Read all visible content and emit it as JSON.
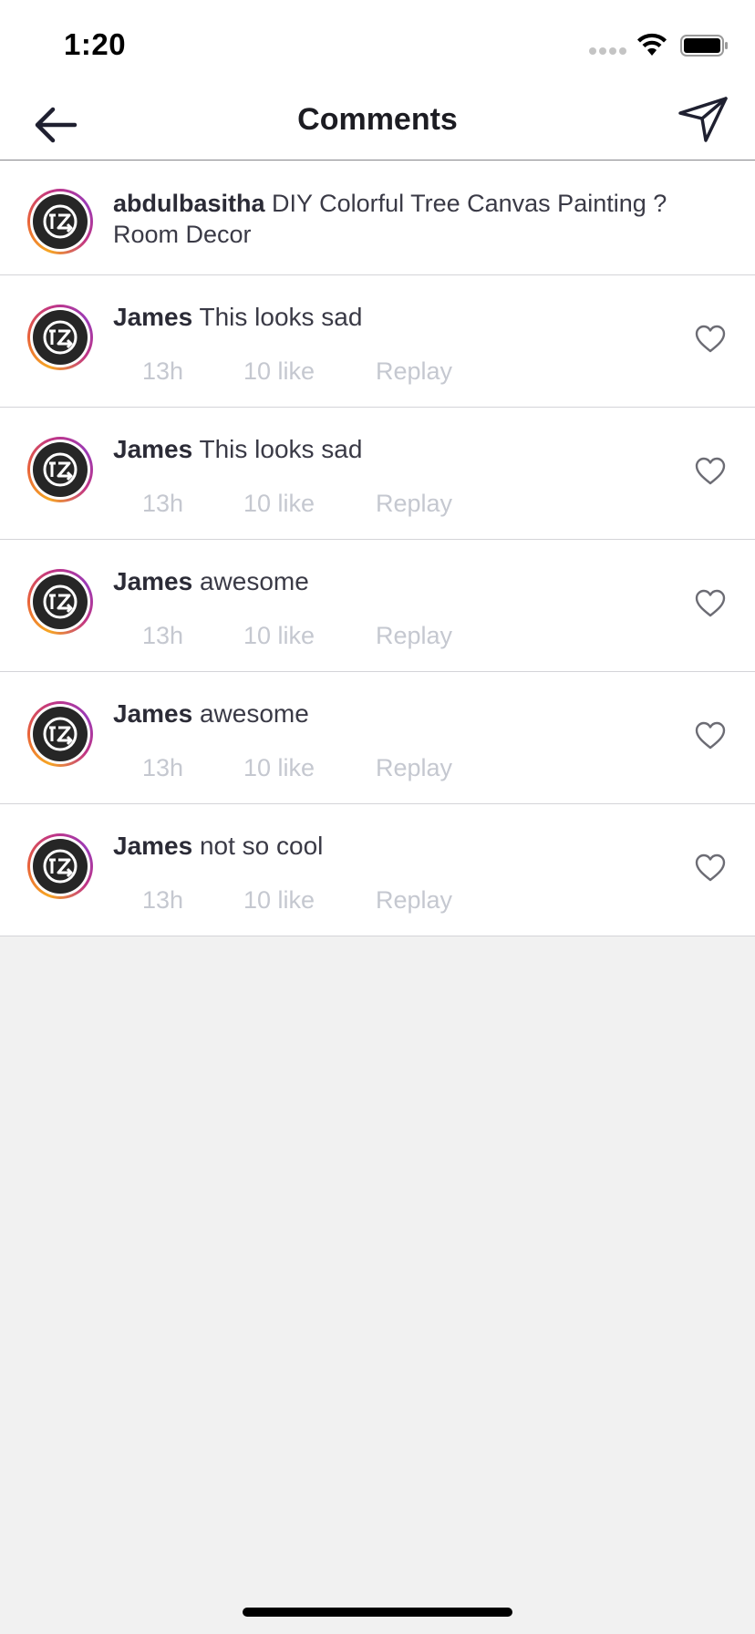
{
  "status_bar": {
    "time": "1:20"
  },
  "nav": {
    "title": "Comments",
    "back_icon": "arrow-left-icon",
    "send_icon": "paper-plane-icon"
  },
  "caption": {
    "username": "abdulbasitha",
    "text": "DIY Colorful Tree Canvas Painting ? Room Decor"
  },
  "comments": [
    {
      "username": "James",
      "text": "This looks sad",
      "time": "13h",
      "likes": "10 like",
      "reply": "Replay"
    },
    {
      "username": "James",
      "text": "This looks sad",
      "time": "13h",
      "likes": "10 like",
      "reply": "Replay"
    },
    {
      "username": "James",
      "text": "awesome",
      "time": "13h",
      "likes": "10 like",
      "reply": "Replay"
    },
    {
      "username": "James",
      "text": "awesome",
      "time": "13h",
      "likes": "10 like",
      "reply": "Replay"
    },
    {
      "username": "James",
      "text": "not so cool",
      "time": "13h",
      "likes": "10 like",
      "reply": "Replay"
    }
  ],
  "colors": {
    "background": "#f1f1f1",
    "text": "#3a3a46",
    "meta": "#c5c8d0",
    "divider": "#d4d4d8"
  }
}
